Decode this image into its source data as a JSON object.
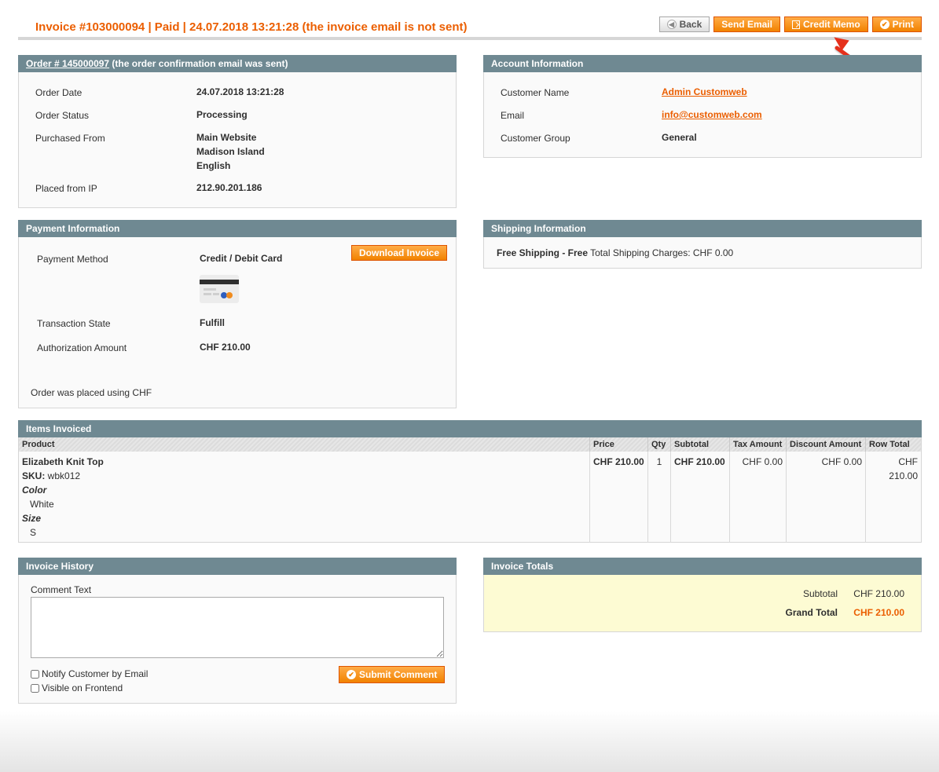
{
  "header": {
    "title": "Invoice #103000094 | Paid | 24.07.2018 13:21:28 (the invoice email is not sent)",
    "buttons": {
      "back": "Back",
      "send_email": "Send Email",
      "credit_memo": "Credit Memo",
      "print": "Print"
    }
  },
  "order_box": {
    "order_link": "Order # 145000097",
    "header_suffix": " (the order confirmation email was sent)",
    "rows": {
      "order_date_label": "Order Date",
      "order_date": "24.07.2018 13:21:28",
      "order_status_label": "Order Status",
      "order_status": "Processing",
      "purchased_from_label": "Purchased From",
      "purchased_from_1": "Main Website",
      "purchased_from_2": "Madison Island",
      "purchased_from_3": "English",
      "placed_ip_label": "Placed from IP",
      "placed_ip": "212.90.201.186"
    }
  },
  "account_box": {
    "title": "Account Information",
    "customer_name_label": "Customer Name",
    "customer_name": "Admin Customweb",
    "email_label": "Email",
    "email": "info@customweb.com",
    "group_label": "Customer Group",
    "group": "General"
  },
  "payment_box": {
    "title": "Payment Information",
    "download_button": "Download Invoice",
    "method_label": "Payment Method",
    "method": "Credit / Debit Card",
    "transaction_label": "Transaction State",
    "transaction": "Fulfill",
    "auth_label": "Authorization Amount",
    "auth": "CHF 210.00",
    "currency_note": "Order was placed using CHF"
  },
  "shipping_box": {
    "title": "Shipping Information",
    "method": "Free Shipping - Free",
    "charges": " Total Shipping Charges: CHF 0.00"
  },
  "items_box": {
    "title": "Items Invoiced",
    "columns": {
      "product": "Product",
      "price": "Price",
      "qty": "Qty",
      "subtotal": "Subtotal",
      "tax": "Tax Amount",
      "discount": "Discount Amount",
      "row_total": "Row Total"
    },
    "item": {
      "name": "Elizabeth Knit Top",
      "sku_label": "SKU:",
      "sku": " wbk012",
      "color_label": "Color",
      "color": "White",
      "size_label": "Size",
      "size": "S",
      "price": "CHF 210.00",
      "qty": "1",
      "subtotal": "CHF 210.00",
      "tax": "CHF 0.00",
      "discount": "CHF 0.00",
      "row_total": "CHF 210.00"
    }
  },
  "history_box": {
    "title": "Invoice History",
    "comment_label": "Comment Text",
    "notify_label": "Notify Customer by Email",
    "visible_label": "Visible on Frontend",
    "submit_button": "Submit Comment"
  },
  "totals_box": {
    "title": "Invoice Totals",
    "subtotal_label": "Subtotal",
    "subtotal": "CHF 210.00",
    "grand_total_label": "Grand Total",
    "grand_total": "CHF 210.00"
  },
  "colors": {
    "accent": "#eb5e00",
    "header_bar": "#6f8992",
    "arrow": "#e5301c",
    "totals_bg": "#fdfbd3"
  }
}
